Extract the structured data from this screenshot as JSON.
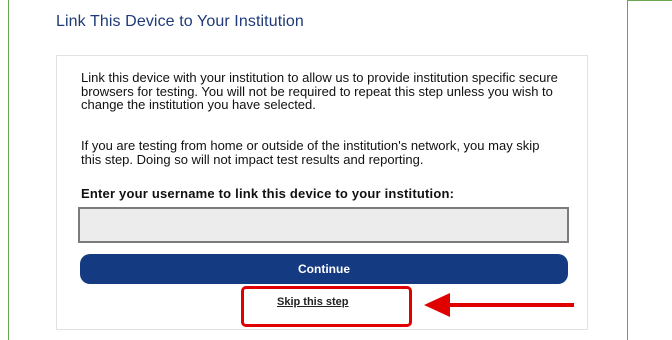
{
  "dialog": {
    "title": "Link This Device to Your Institution",
    "paragraph_1": "Link this device with your institution to allow us to provide institution specific secure browsers for testing. You will not be required to repeat this step unless you wish to change the institution you have selected.",
    "paragraph_2": "If you are testing from home or outside of the institution's network, you may skip this step. Doing so will not impact test results and reporting.",
    "username_label": "Enter your username to link this device to your institution:",
    "username_value": "",
    "username_placeholder": "",
    "continue_label": "Continue",
    "skip_label": "Skip this step"
  },
  "annotation": {
    "highlight_color": "#e00000",
    "arrow_color": "#e00000"
  },
  "colors": {
    "title": "#1f3a78",
    "button": "#143a82",
    "frame": "#6aa84f"
  }
}
